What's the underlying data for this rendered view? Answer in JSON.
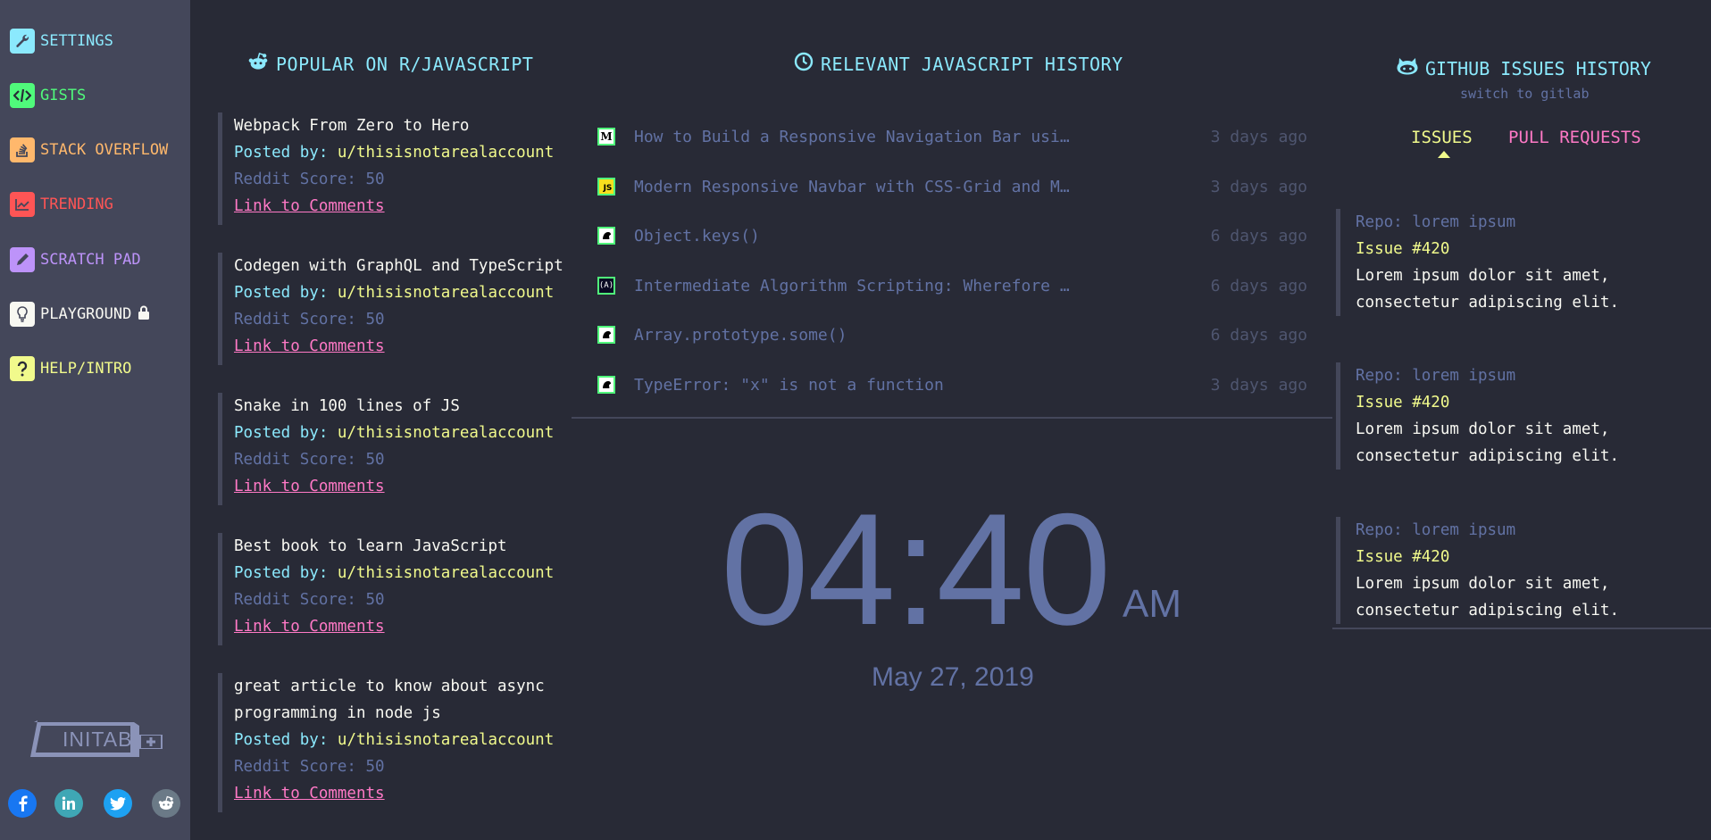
{
  "sidebar": {
    "items": [
      {
        "label": "SETTINGS",
        "color": "#8be9fd",
        "icon": "wrench-icon"
      },
      {
        "label": "GISTS",
        "color": "#50fa7b",
        "icon": "code-icon"
      },
      {
        "label": "STACK OVERFLOW",
        "color": "#ffb86c",
        "icon": "stack-overflow-icon"
      },
      {
        "label": "TRENDING",
        "color": "#ff5555",
        "icon": "chart-icon"
      },
      {
        "label": "SCRATCH PAD",
        "color": "#bd93f9",
        "icon": "pencil-icon"
      },
      {
        "label": "PLAYGROUND",
        "color": "#f8f8f2",
        "icon": "lightbulb-icon"
      },
      {
        "label": "HELP/INTRO",
        "color": "#f1fa8c",
        "icon": "question-icon"
      }
    ],
    "brand": "INITAB",
    "social": [
      "facebook-icon",
      "linkedin-icon",
      "twitter-icon",
      "reddit-icon"
    ]
  },
  "reddit": {
    "title": "POPULAR ON R/JAVASCRIPT",
    "posted_label": "Posted by:",
    "posts": [
      {
        "title": "Webpack From Zero to Hero",
        "user": "u/thisisnotarealaccount",
        "score": "Reddit Score: 50",
        "link": "Link to Comments"
      },
      {
        "title": "Codegen with GraphQL and TypeScript",
        "user": "u/thisisnotarealaccount",
        "score": "Reddit Score: 50",
        "link": "Link to Comments"
      },
      {
        "title": "Snake in 100 lines of JS",
        "user": "u/thisisnotarealaccount",
        "score": "Reddit Score: 50",
        "link": "Link to Comments"
      },
      {
        "title": "Best book to learn JavaScript",
        "user": "u/thisisnotarealaccount",
        "score": "Reddit Score: 50",
        "link": "Link to Comments"
      },
      {
        "title": "great article to know about async programming in node js",
        "user": "u/thisisnotarealaccount",
        "score": "Reddit Score: 50",
        "link": "Link to Comments"
      }
    ]
  },
  "history": {
    "title": "RELEVANT JAVASCRIPT HISTORY",
    "items": [
      {
        "text": "How to Build a Responsive Navigation Bar usi…",
        "time": "3 days ago",
        "icon": "medium-icon"
      },
      {
        "text": "Modern Responsive Navbar with CSS-Grid and M…",
        "time": "3 days ago",
        "icon": "js-icon"
      },
      {
        "text": "Object.keys()",
        "time": "6 days ago",
        "icon": "mdn-icon"
      },
      {
        "text": "Intermediate Algorithm Scripting: Wherefore …",
        "time": "6 days ago",
        "icon": "freecodecamp-icon"
      },
      {
        "text": "Array.prototype.some()",
        "time": "6 days ago",
        "icon": "mdn-icon"
      },
      {
        "text": "TypeError: \"x\" is not a function",
        "time": "3 days ago",
        "icon": "mdn-icon"
      }
    ]
  },
  "clock": {
    "time": "04:40",
    "ampm": "AM",
    "date": "May 27, 2019"
  },
  "github": {
    "title": "GITHUB ISSUES HISTORY",
    "switch": "switch to gitlab",
    "tabs": [
      "ISSUES",
      "PULL REQUESTS"
    ],
    "active_tab": "ISSUES",
    "issues": [
      {
        "repo": "Repo: lorem ipsum",
        "issue": "Issue #420",
        "desc": "Lorem ipsum dolor sit amet, consectetur adipiscing elit."
      },
      {
        "repo": "Repo: lorem ipsum",
        "issue": "Issue #420",
        "desc": "Lorem ipsum dolor sit amet, consectetur adipiscing elit."
      },
      {
        "repo": "Repo: lorem ipsum",
        "issue": "Issue #420",
        "desc": "Lorem ipsum dolor sit amet, consectetur adipiscing elit."
      }
    ]
  },
  "colors": {
    "background": "#282a36",
    "sidebar": "#44475a",
    "cyan": "#8be9fd",
    "yellow": "#f1fa8c",
    "pink": "#ff79c6",
    "muted": "#6272a4"
  }
}
